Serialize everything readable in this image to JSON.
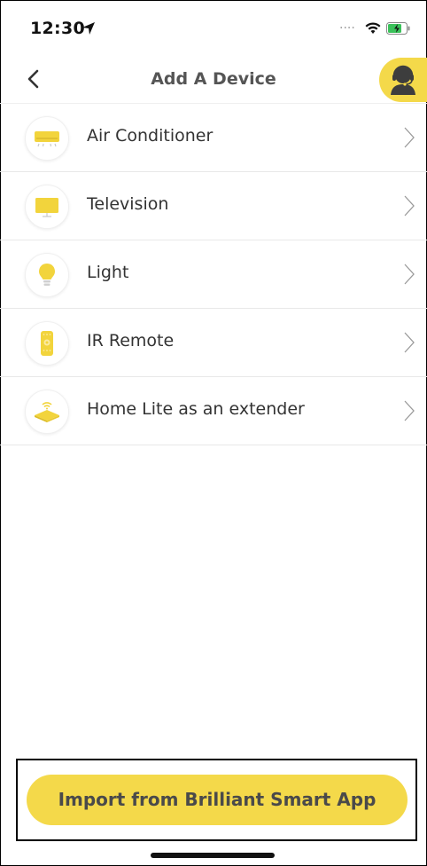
{
  "status_bar": {
    "time": "12:30",
    "signal_dots": "....",
    "icons": [
      "location-arrow-icon",
      "wifi-icon",
      "battery-charging-icon"
    ]
  },
  "header": {
    "title": "Add A Device",
    "back_icon": "chevron-left-icon",
    "support_icon": "support-agent-icon"
  },
  "devices": [
    {
      "label": "Air Conditioner",
      "icon": "air-conditioner-icon"
    },
    {
      "label": "Television",
      "icon": "television-icon"
    },
    {
      "label": "Light",
      "icon": "light-bulb-icon"
    },
    {
      "label": "IR Remote",
      "icon": "ir-remote-icon"
    },
    {
      "label": "Home Lite as an extender",
      "icon": "wifi-extender-icon"
    }
  ],
  "footer": {
    "import_label": "Import from Brilliant Smart App"
  },
  "colors": {
    "accent": "#f4d94a",
    "icon_fill": "#f2d43c",
    "text": "#333333",
    "divider": "#e8e8e8"
  }
}
